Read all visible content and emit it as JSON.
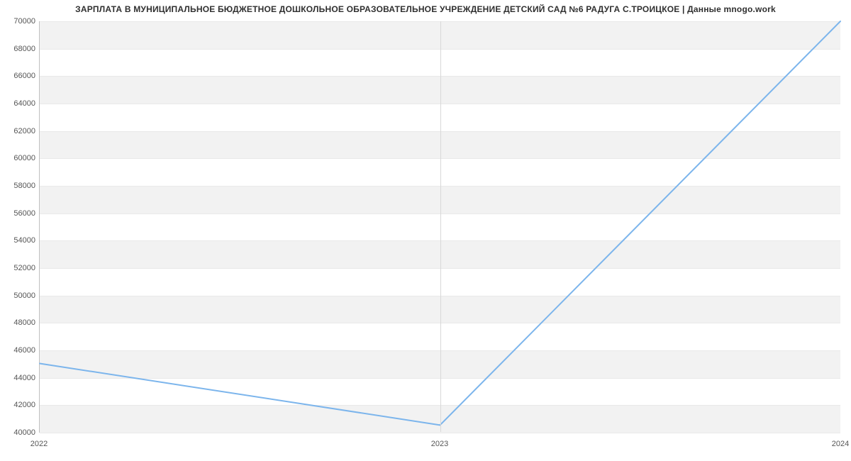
{
  "chart_data": {
    "type": "line",
    "title": "ЗАРПЛАТА В МУНИЦИПАЛЬНОЕ БЮДЖЕТНОЕ ДОШКОЛЬНОЕ ОБРАЗОВАТЕЛЬНОЕ УЧРЕЖДЕНИЕ ДЕТСКИЙ САД №6 РАДУГА С.ТРОИЦКОЕ | Данные mnogo.work",
    "x": [
      2022,
      2023,
      2024
    ],
    "values": [
      45000,
      40500,
      70000
    ],
    "x_ticks": [
      2022,
      2023,
      2024
    ],
    "y_ticks": [
      40000,
      42000,
      44000,
      46000,
      48000,
      50000,
      52000,
      54000,
      56000,
      58000,
      60000,
      62000,
      64000,
      66000,
      68000,
      70000
    ],
    "ylim": [
      40000,
      70000
    ],
    "xlim": [
      2022,
      2024
    ],
    "xlabel": "",
    "ylabel": "",
    "series_color": "#7cb5ec",
    "band_color": "#f2f2f2"
  }
}
